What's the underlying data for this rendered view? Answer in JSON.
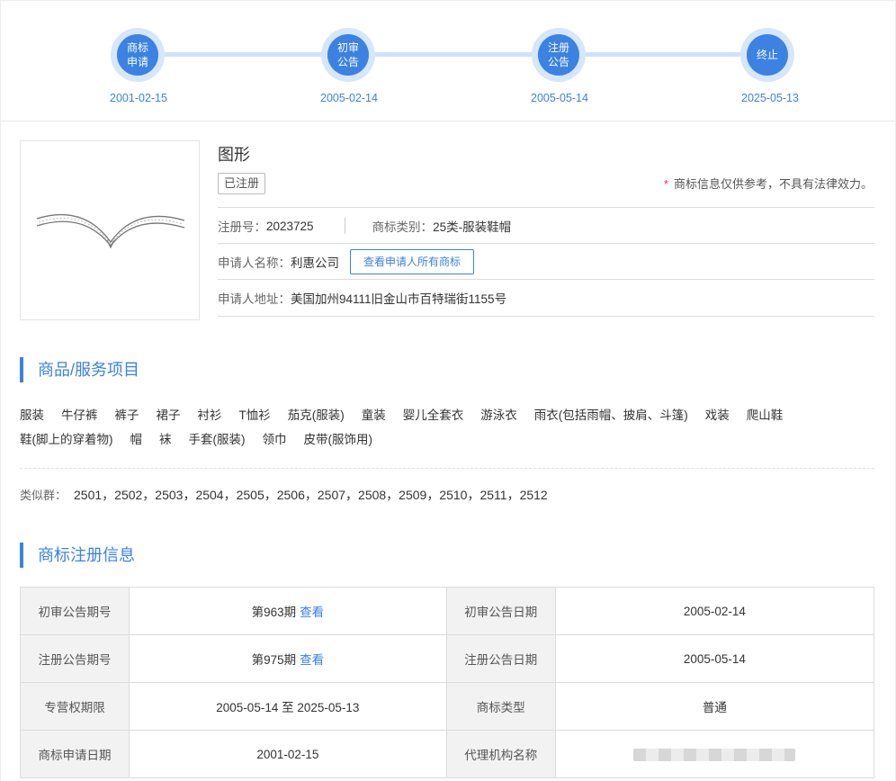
{
  "timeline": [
    {
      "label": "商标\n申请",
      "date": "2001-02-15"
    },
    {
      "label": "初审\n公告",
      "date": "2005-02-14"
    },
    {
      "label": "注册\n公告",
      "date": "2005-05-14"
    },
    {
      "label": "终止",
      "date": "2025-05-13"
    }
  ],
  "header": {
    "name": "图形",
    "status": "已注册",
    "disclaimer_star": "*",
    "disclaimer": "商标信息仅供参考，不具有法律效力。",
    "reg_no_label": "注册号：",
    "reg_no": "2023725",
    "class_label": "商标类别：",
    "class_value": "25类-服装鞋帽",
    "applicant_label": "申请人名称：",
    "applicant": "利惠公司",
    "view_all_button": "查看申请人所有商标",
    "address_label": "申请人地址：",
    "address": "美国加州94111旧金山市百特瑞街1155号"
  },
  "goods_section": {
    "title": "商品/服务项目",
    "items": [
      "服装",
      "牛仔裤",
      "裤子",
      "裙子",
      "衬衫",
      "T恤衫",
      "茄克(服装)",
      "童装",
      "婴儿全套衣",
      "游泳衣",
      "雨衣(包括雨帽、披肩、斗篷)",
      "戏装",
      "爬山鞋",
      "鞋(脚上的穿着物)",
      "帽",
      "袜",
      "手套(服装)",
      "领巾",
      "皮带(服饰用)"
    ],
    "similar_label": "类似群：",
    "similar_groups": "2501，2502，2503，2504，2505，2506，2507，2508，2509，2510，2511，2512"
  },
  "reg_section": {
    "title": "商标注册信息",
    "view_link": "查看",
    "rows": [
      {
        "l1": "初审公告期号",
        "v1": "第963期",
        "v1_link": true,
        "l2": "初审公告日期",
        "v2": "2005-02-14"
      },
      {
        "l1": "注册公告期号",
        "v1": "第975期",
        "v1_link": true,
        "l2": "注册公告日期",
        "v2": "2005-05-14"
      },
      {
        "l1": "专营权期限",
        "v1": "2005-05-14 至 2025-05-13",
        "v1_link": false,
        "l2": "商标类型",
        "v2": "普通"
      },
      {
        "l1": "商标申请日期",
        "v1": "2001-02-15",
        "v1_link": false,
        "l2": "代理机构名称",
        "v2": ""
      }
    ]
  },
  "colors": {
    "accent": "#3b82e3",
    "accent_light": "#d6e6fb"
  }
}
